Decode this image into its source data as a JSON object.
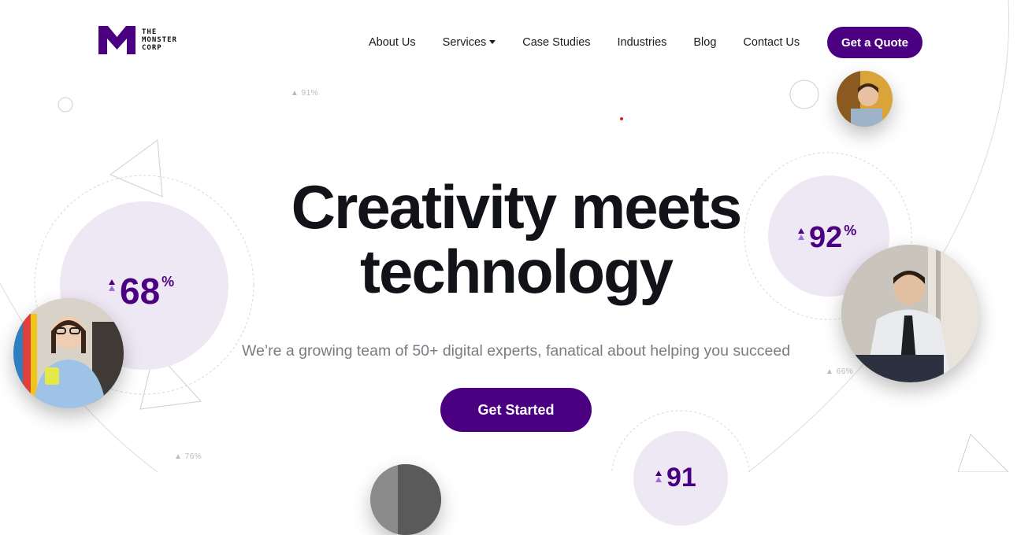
{
  "brand": {
    "logo_text": [
      "THE",
      "MONSTER",
      "CORP"
    ],
    "accent": "#4b0082",
    "accent_light": "#eee8f4"
  },
  "nav": {
    "items": [
      {
        "label": "About Us"
      },
      {
        "label": "Services",
        "has_dropdown": true
      },
      {
        "label": "Case Studies"
      },
      {
        "label": "Industries"
      },
      {
        "label": "Blog"
      },
      {
        "label": "Contact Us"
      }
    ],
    "cta_label": "Get a Quote"
  },
  "hero": {
    "title_line1": "Creativity meets",
    "title_line2": "technology",
    "subtitle": "We’re a growing team of 50+ digital experts, fanatical about helping you succeed",
    "cta_label": "Get Started"
  },
  "stats": {
    "left": {
      "value": "68",
      "unit": "%"
    },
    "right": {
      "value": "92",
      "unit": "%"
    },
    "bottom": {
      "value": "91"
    }
  },
  "small_stats": [
    "▲ 91%",
    "▲ 66%",
    "▲ 76%"
  ],
  "icons": [
    "logo-m-icon",
    "caret-down-icon",
    "arrow-up-icon"
  ]
}
